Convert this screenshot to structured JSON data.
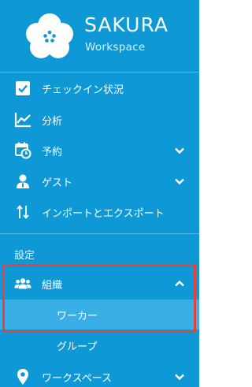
{
  "brand": {
    "title": "SAKURA",
    "subtitle": "Workspace"
  },
  "nav": {
    "checkin": "チェックイン状況",
    "analytics": "分析",
    "reservations": "予約",
    "guests": "ゲスト",
    "import_export": "インポートとエクスポート"
  },
  "settings": {
    "section_label": "設定",
    "organization": "組織",
    "workers": "ワーカー",
    "groups": "グループ",
    "workspace": "ワークスペース"
  },
  "icons": [
    "sakura-logo",
    "checkbox-icon",
    "chart-line-icon",
    "calendar-clock-icon",
    "guest-icon",
    "sort-arrows-icon",
    "people-icon",
    "location-pin-icon",
    "chevron-down-icon",
    "chevron-up-icon"
  ],
  "colors": {
    "sidebar_bg": "#0e98d6",
    "active_bg": "#3aaee6",
    "highlight": "#e8413a"
  }
}
